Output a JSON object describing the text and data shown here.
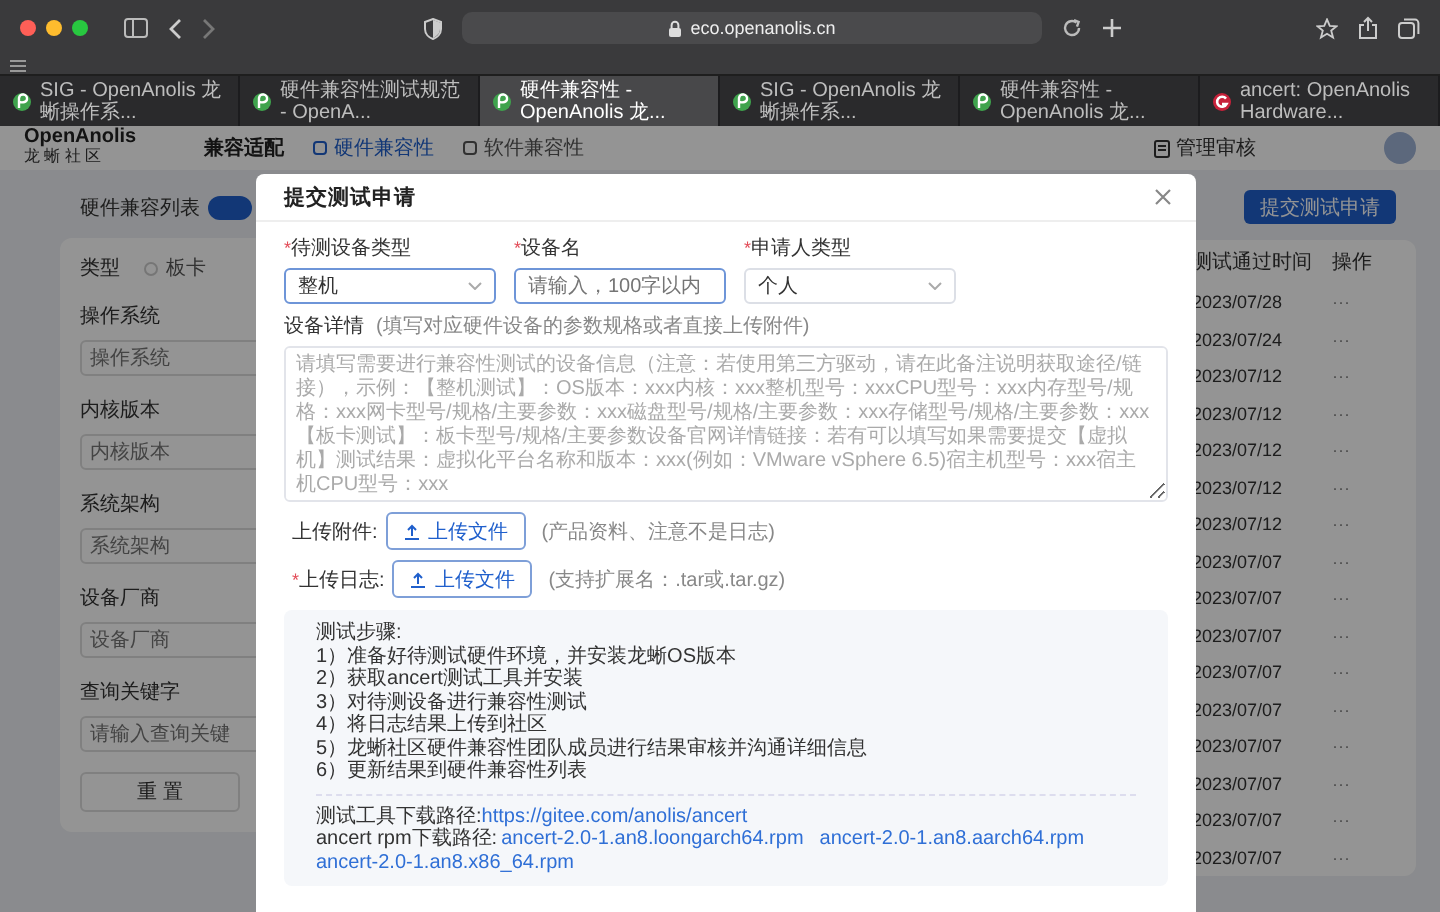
{
  "browser": {
    "url": "eco.openanolis.cn",
    "tabs": [
      {
        "title": "SIG - OpenAnolis 龙蜥操作系...",
        "kind": "leaf",
        "selected": false
      },
      {
        "title": "硬件兼容性测试规范 - OpenA...",
        "kind": "leaf",
        "selected": false
      },
      {
        "title": "硬件兼容性 - OpenAnolis 龙...",
        "kind": "leaf",
        "selected": true
      },
      {
        "title": "SIG - OpenAnolis 龙蜥操作系...",
        "kind": "leaf",
        "selected": false
      },
      {
        "title": "硬件兼容性 - OpenAnolis 龙...",
        "kind": "leaf",
        "selected": false
      },
      {
        "title": "ancert: OpenAnolis Hardware...",
        "kind": "circle",
        "selected": false
      }
    ]
  },
  "site": {
    "logo": "OpenAnolis",
    "logo_sub": "龙 蜥 社 区",
    "section": "兼容适配",
    "nav": [
      {
        "label": "硬件兼容性",
        "selected": true
      },
      {
        "label": "软件兼容性",
        "selected": false
      }
    ],
    "admin": "管理审核"
  },
  "list": {
    "title": "硬件兼容列表",
    "submit": "提交测试申请",
    "type_label": "类型",
    "type_option": {
      "label": "板卡",
      "selected": false
    },
    "filters": [
      {
        "label": "操作系统",
        "placeholder": "操作系统"
      },
      {
        "label": "内核版本",
        "placeholder": "内核版本"
      },
      {
        "label": "系统架构",
        "placeholder": "系统架构"
      },
      {
        "label": "设备厂商",
        "placeholder": "设备厂商"
      },
      {
        "label": "查询关键字",
        "placeholder": "请输入查询关键"
      }
    ],
    "reset": "重 置",
    "columns": [
      "测试通过时间",
      "操作"
    ],
    "rows": [
      {
        "date": "2023/07/28",
        "action": "···"
      },
      {
        "date": "2023/07/24",
        "action": "···"
      },
      {
        "date": "2023/07/12",
        "action": "···"
      },
      {
        "date": "2023/07/12",
        "action": "···"
      },
      {
        "date": "2023/07/12",
        "action": "···"
      },
      {
        "date": "2023/07/12",
        "action": "···"
      },
      {
        "date": "2023/07/12",
        "action": "···"
      },
      {
        "date": "2023/07/07",
        "action": "···"
      },
      {
        "date": "2023/07/07",
        "action": "···"
      },
      {
        "date": "2023/07/07",
        "action": "···"
      },
      {
        "date": "2023/07/07",
        "action": "···"
      },
      {
        "date": "2023/07/07",
        "action": "···"
      },
      {
        "date": "2023/07/07",
        "action": "···"
      },
      {
        "date": "2023/07/07",
        "action": "···"
      },
      {
        "date": "2023/07/07",
        "action": "···"
      },
      {
        "date": "2023/07/07",
        "action": "···"
      }
    ]
  },
  "dialog": {
    "title": "提交测试申请",
    "required_mark": "*",
    "fields": [
      {
        "label": "待测设备类型",
        "required": true,
        "kind": "select",
        "value": "整机",
        "focused": true
      },
      {
        "label": "设备名",
        "required": true,
        "kind": "input",
        "placeholder": "请输入，100字以内",
        "focused": true
      },
      {
        "label": "申请人类型",
        "required": true,
        "kind": "select",
        "value": "个人",
        "focused": false
      }
    ],
    "details_label": "设备详情",
    "details_hint": "(填写对应硬件设备的参数规格或者直接上传附件)",
    "details_placeholder": "请填写需要进行兼容性测试的设备信息（注意：若使用第三方驱动，请在此备注说明获取途径/链接），示例：【整机测试】：OS版本：xxx内核：xxx整机型号：xxxCPU型号：xxx内存型号/规格：xxx网卡型号/规格/主要参数：xxx磁盘型号/规格/主要参数：xxx存储型号/规格/主要参数：xxx【板卡测试】：板卡型号/规格/主要参数设备官网详情链接：若有可以填写如果需要提交【虚拟机】测试结果：虚拟化平台名称和版本：xxx(例如：VMware vSphere 6.5)宿主机型号：xxx宿主机CPU型号：xxx",
    "uploads": [
      {
        "label": "上传附件:",
        "required": false,
        "button": "上传文件",
        "hint": "(产品资料、注意不是日志)"
      },
      {
        "label": "上传日志:",
        "required": true,
        "button": "上传文件",
        "hint": "(支持扩展名：.tar或.tar.gz)"
      }
    ],
    "steps_title": "测试步骤:",
    "steps": [
      "1）准备好待测试硬件环境，并安装龙蜥OS版本",
      "2）获取ancert测试工具并安装",
      "3）对待测设备进行兼容性测试",
      "4）将日志结果上传到社区",
      "5）龙蜥社区硬件兼容性团队成员进行结果审核并沟通详细信息",
      "6）更新结果到硬件兼容性列表"
    ],
    "tool_label": "测试工具下载路径:",
    "tool_link": "https://gitee.com/anolis/ancert",
    "rpm_label": "ancert rpm下载路径:",
    "rpm_links": [
      "ancert-2.0-1.an8.loongarch64.rpm",
      "ancert-2.0-1.an8.aarch64.rpm",
      "ancert-2.0-1.an8.x86_64.rpm"
    ]
  }
}
